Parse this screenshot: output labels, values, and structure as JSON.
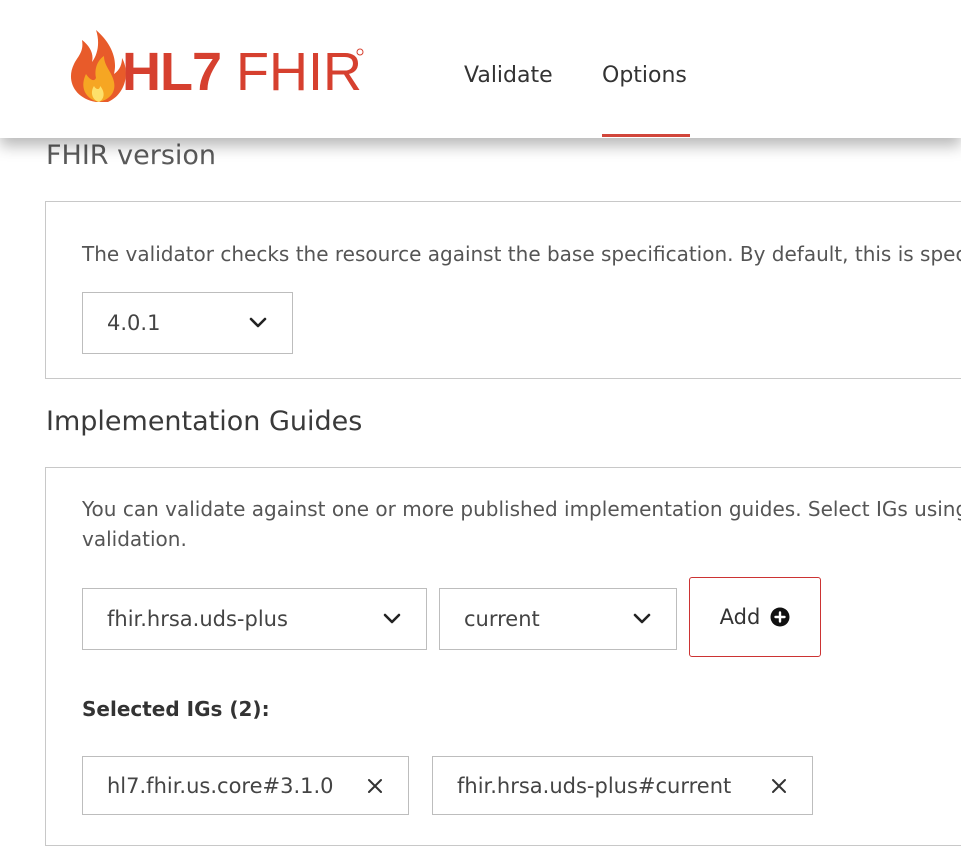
{
  "header": {
    "logo_text": "HL7 FHIR",
    "nav": [
      {
        "label": "Validate"
      },
      {
        "label": "Options"
      }
    ],
    "active_tab": "Options"
  },
  "fhir_version": {
    "title": "FHIR version",
    "description": "The validator checks the resource against the base specification. By default, this is specifi",
    "selected": "4.0.1"
  },
  "implementation_guides": {
    "title": "Implementation Guides",
    "description_line1": "You can validate against one or more published implementation guides. Select IGs using t",
    "description_line2": "validation.",
    "ig_select": "fhir.hrsa.uds-plus",
    "version_select": "current",
    "add_label": "Add",
    "selected_label": "Selected IGs (2):",
    "selected": [
      {
        "label": "hl7.fhir.us.core#3.1.0"
      },
      {
        "label": "fhir.hrsa.uds-plus#current"
      }
    ]
  },
  "colors": {
    "accent": "#d1463b",
    "add_border": "#cc3333",
    "panel_border": "#c8c8c8"
  },
  "icons": [
    "flame-logo-icon",
    "chevron-down-icon",
    "plus-circle-icon",
    "close-icon"
  ]
}
